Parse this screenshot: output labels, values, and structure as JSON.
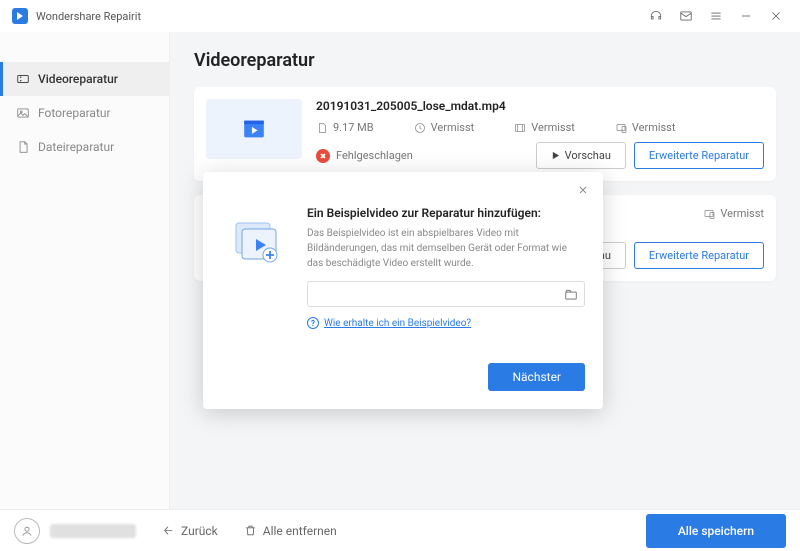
{
  "app": {
    "title": "Wondershare Repairit"
  },
  "sidebar": {
    "items": [
      {
        "label": "Videoreparatur"
      },
      {
        "label": "Fotoreparatur"
      },
      {
        "label": "Dateireparatur"
      }
    ]
  },
  "page": {
    "title": "Videoreparatur"
  },
  "file1": {
    "name": "20191031_205005_lose_mdat.mp4",
    "size": "9.17  MB",
    "duration": "Vermisst",
    "resolution": "Vermisst",
    "device": "Vermisst",
    "status": "Fehlgeschlagen",
    "preview": "Vorschau",
    "advanced": "Erweiterte Reparatur"
  },
  "file2": {
    "device": "Vermisst",
    "preview": "orschau",
    "advanced": "Erweiterte Reparatur"
  },
  "modal": {
    "title": "Ein Beispielvideo zur Reparatur hinzufügen:",
    "desc": "Das Beispielvideo ist ein abspielbares Video mit Bildänderungen, das mit demselben Gerät oder Format wie das beschädigte Video erstellt wurde.",
    "help": "Wie erhalte ich ein Beispielvideo?",
    "next": "Nächster",
    "input": ""
  },
  "footer": {
    "back": "Zurück",
    "remove_all": "Alle entfernen",
    "save_all": "Alle speichern"
  }
}
